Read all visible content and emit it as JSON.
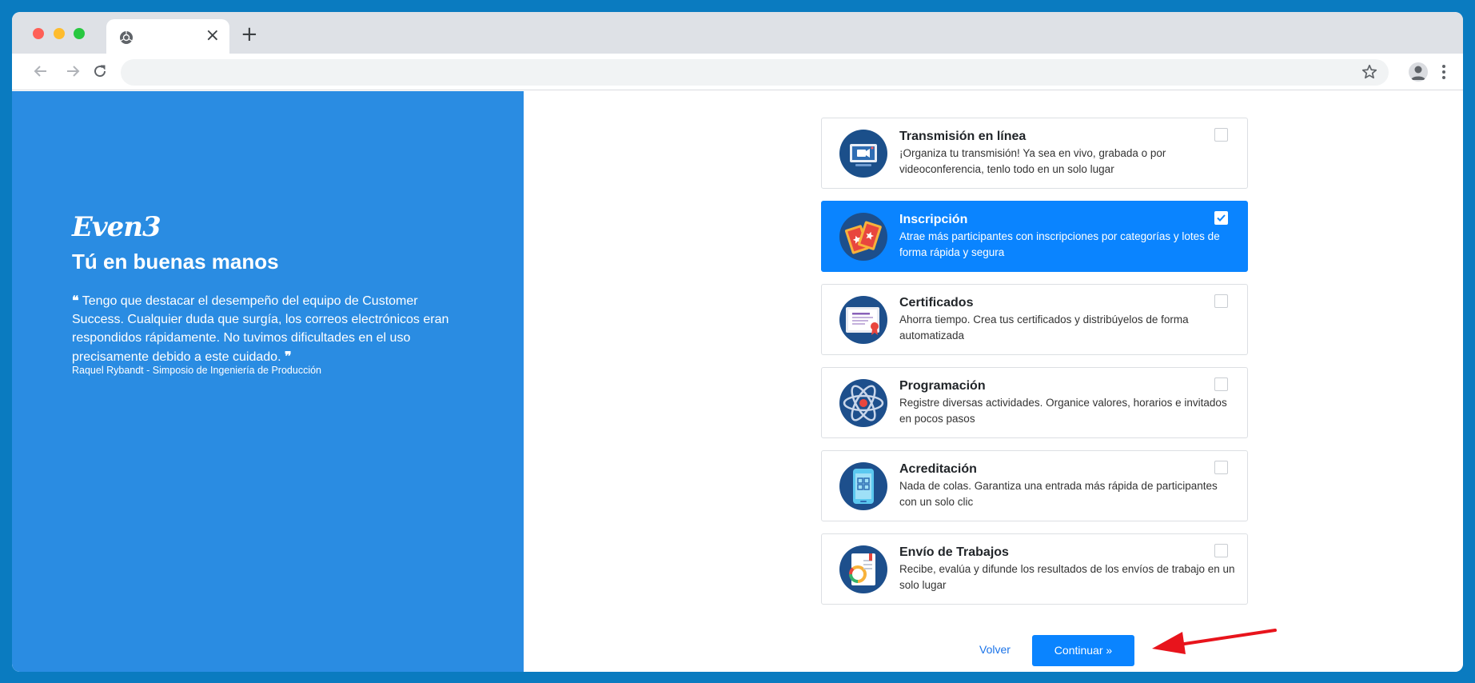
{
  "browser": {
    "tab_close": "×",
    "new_tab": "+"
  },
  "left_panel": {
    "logo": "Even3",
    "tagline": "Tú en buenas manos",
    "quote_open": "❝",
    "quote": "Tengo que destacar el desempeño del equipo de Customer Success. Cualquier duda que surgía, los correos electrónicos eran respondidos rápidamente. No tuvimos dificultades en el uso precisamente debido a este cuidado.",
    "quote_close": "❞",
    "author": "Raquel Rybandt - Simposio de Ingeniería de Producción",
    "background_color": "#2a8ce2"
  },
  "modules": [
    {
      "title": "Transmisión en línea",
      "description": "¡Organiza tu transmisión! Ya sea en vivo, grabada o por videoconferencia, tenlo todo en un solo lugar",
      "icon": "streaming-icon",
      "checked": false
    },
    {
      "title": "Inscripción",
      "description": "Atrae más participantes con inscripciones por categorías y lotes de forma rápida y segura",
      "icon": "ticket-icon",
      "checked": true
    },
    {
      "title": "Certificados",
      "description": "Ahorra tiempo. Crea tus certificados y distribúyelos de forma automatizada",
      "icon": "certificate-icon",
      "checked": false
    },
    {
      "title": "Programación",
      "description": "Registre diversas actividades. Organice valores, horarios e invitados en pocos pasos",
      "icon": "atom-icon",
      "checked": false
    },
    {
      "title": "Acreditación",
      "description": "Nada de colas. Garantiza una entrada más rápida de participantes con un solo clic",
      "icon": "qr-phone-icon",
      "checked": false
    },
    {
      "title": "Envío de Trabajos",
      "description": "Recibe, evalúa y difunde los resultados de los envíos de trabajo en un solo lugar",
      "icon": "document-chart-icon",
      "checked": false
    }
  ],
  "actions": {
    "back_label": "Volver",
    "continue_label": "Continuar »"
  },
  "colors": {
    "accent": "#0a84ff",
    "annotation_arrow": "#e8141c"
  }
}
